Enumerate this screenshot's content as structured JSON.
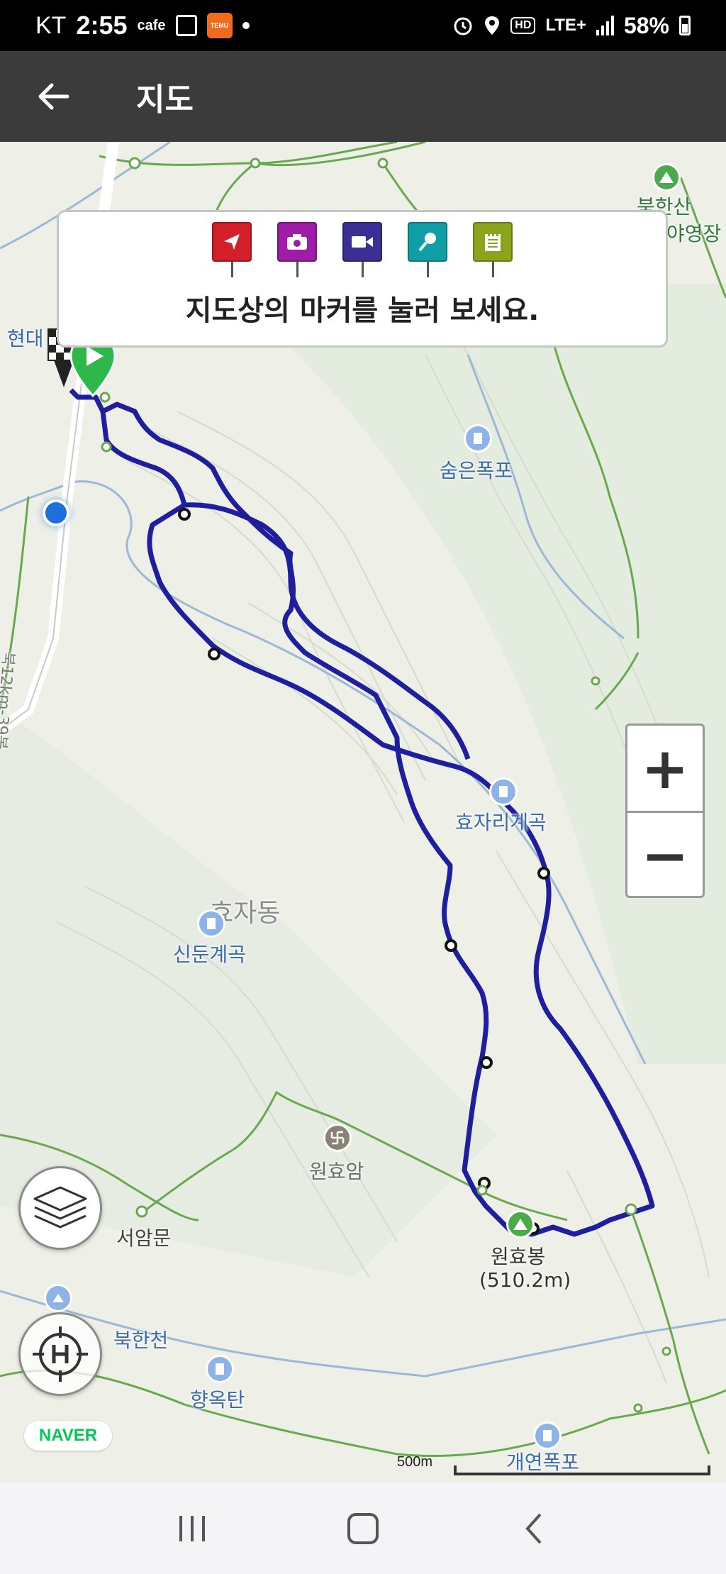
{
  "status_bar": {
    "carrier": "KT",
    "time": "2:55",
    "cafe": "cafe",
    "temu": "TEMU",
    "hd": "HD",
    "lte": "LTE+",
    "battery": "58%"
  },
  "app_bar": {
    "title": "지도",
    "back_icon": "arrow-left-icon"
  },
  "info_card": {
    "message": "지도상의 마커를 눌러 보세요.",
    "markers": [
      {
        "type": "direction",
        "icon": "navigation-arrow-icon",
        "color": "#d31f2a"
      },
      {
        "type": "photo",
        "icon": "camera-icon",
        "color": "#a01ca6"
      },
      {
        "type": "video",
        "icon": "video-camera-icon",
        "color": "#3b2f96"
      },
      {
        "type": "audio",
        "icon": "microphone-icon",
        "color": "#0f9ea4"
      },
      {
        "type": "memo",
        "icon": "notepad-icon",
        "color": "#8aa41c"
      }
    ]
  },
  "map": {
    "labels": {
      "bukhansan": "북한산",
      "camp": "야영장",
      "hyundai": "현대",
      "sumeun": "숨은폭포",
      "road": "북12km-39봉",
      "hyojari": "효자리계곡",
      "hyojadong": "효자동",
      "sindun": "신둔계곡",
      "wonhyoam": "원효암",
      "seoammun": "서암문",
      "wonhyobong": "원효봉",
      "wonhyobong_elev": "(510.2m)",
      "bukhancheon": "북한천",
      "hyangoktan": "향옥탄",
      "gaeyeon": "개연폭포"
    },
    "scale_label": "500m",
    "logo": "NAVER",
    "track_color": "#1f1f9e"
  },
  "controls": {
    "zoom_in": "+",
    "zoom_out": "−",
    "layers_icon": "layers-icon",
    "location_icon": "crosshair-h-icon"
  },
  "nav_bar": {
    "recent_icon": "recent-apps-icon",
    "home_icon": "home-icon",
    "back_icon": "back-chevron-icon"
  }
}
